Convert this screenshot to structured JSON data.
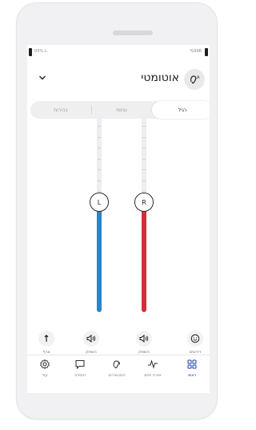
{
  "status": {
    "left_battery": "93% L",
    "right_battery": "%99R"
  },
  "header": {
    "program_title": "אוטומטי",
    "program_icon": "hearing-aid-a-icon"
  },
  "tabs": [
    {
      "label": "בהירות",
      "selected": false
    },
    {
      "label": "נוחות",
      "selected": false
    },
    {
      "label": "רגיל",
      "selected": true
    }
  ],
  "sliders": {
    "left": {
      "label": "L",
      "color": "#2b86c5",
      "level": 0.36
    },
    "right": {
      "label": "R",
      "color": "#d42d3a",
      "level": 0.36
    }
  },
  "quick_actions": [
    {
      "label": "צרף",
      "icon": "pin-icon"
    },
    {
      "label": "השתק",
      "icon": "speaker-icon"
    },
    {
      "label": "השתק",
      "icon": "speaker-icon"
    },
    {
      "label": "דירוגים",
      "icon": "smiley-icon"
    }
  ],
  "nav": [
    {
      "label": "עוד",
      "icon": "gear-icon",
      "active": false
    },
    {
      "label": "תמיכה",
      "icon": "chat-icon",
      "active": false
    },
    {
      "label": "המכשירים",
      "icon": "hearing-aid-icon",
      "active": false
    },
    {
      "label": "אורח חיים",
      "icon": "activity-icon",
      "active": false
    },
    {
      "label": "ראשי",
      "icon": "home-grid-icon",
      "active": true
    }
  ],
  "colors": {
    "accent": "#1a3da8",
    "left_ear": "#2b86c5",
    "right_ear": "#d42d3a"
  }
}
